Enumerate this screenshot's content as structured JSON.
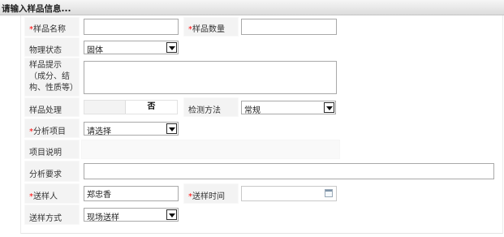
{
  "header": {
    "title": "请输入样品信息..."
  },
  "form": {
    "sample_name": {
      "required_mark": "*",
      "label": "样品名称",
      "value": ""
    },
    "sample_qty": {
      "required_mark": "*",
      "label": "样品数量",
      "value": ""
    },
    "physical_state": {
      "label": "物理状态",
      "value": "固体"
    },
    "sample_hint": {
      "label": "样品提示（成分、结构、性质等）",
      "value": ""
    },
    "sample_handling": {
      "label": "样品处理",
      "value": "否"
    },
    "test_method": {
      "label": "检测方法",
      "value": "常规"
    },
    "analysis_item": {
      "required_mark": "*",
      "label": "分析项目",
      "value": "请选择"
    },
    "item_desc": {
      "label": "项目说明",
      "value": ""
    },
    "analysis_req": {
      "label": "分析要求",
      "value": ""
    },
    "sender": {
      "required_mark": "*",
      "label": "送样人",
      "value": "郑忠香"
    },
    "send_time": {
      "required_mark": "*",
      "label": "送样时间",
      "value": ""
    },
    "send_method": {
      "label": "送样方式",
      "value": "现场送样"
    }
  },
  "icons": {
    "calendar": "calendar-icon",
    "dropdown": "chevron-down-icon"
  }
}
